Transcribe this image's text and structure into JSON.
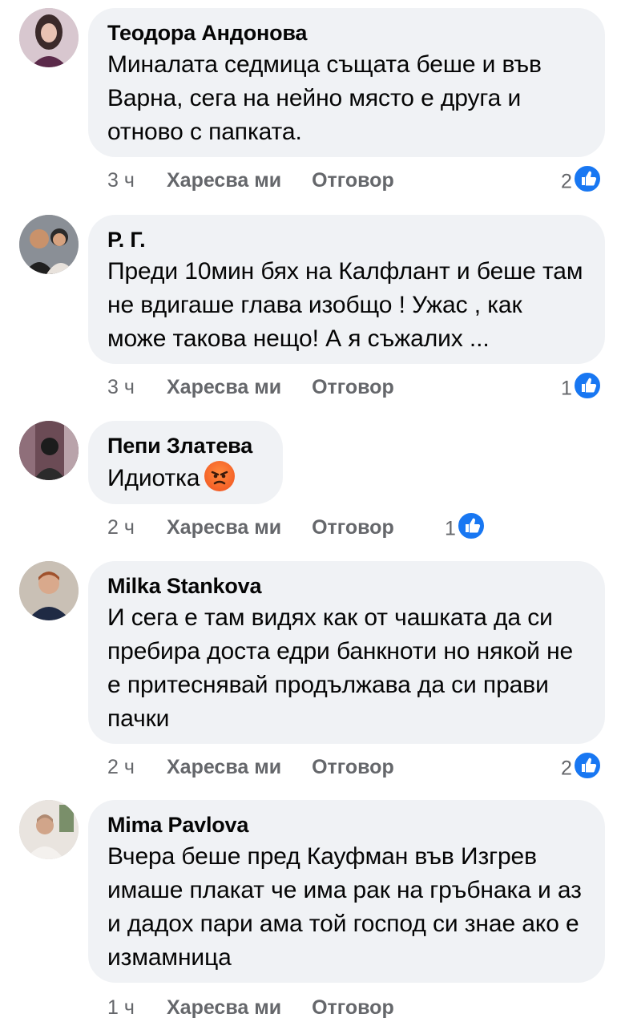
{
  "comments": [
    {
      "author": "Теодора Андонова",
      "text": "Миналата седмица същата беше и във Варна, сега на нейно място е друга и отново с папката.",
      "time": "3 ч",
      "like_label": "Харесва ми",
      "reply_label": "Отговор",
      "reaction_count": "2",
      "reaction_icon": "like-icon",
      "avatar_colors": [
        "#d8c7cf",
        "#3b2a2a",
        "#e8c2b3"
      ]
    },
    {
      "author": "Р. Г.",
      "text": "Преди 10мин бях на Калфлант и беше там не вдигаше глава изобщо ! Ужас , как може такова нещо! А я съжалих ...",
      "time": "3 ч",
      "like_label": "Харесва ми",
      "reply_label": "Отговор",
      "reaction_count": "1",
      "reaction_icon": "like-icon",
      "avatar_colors": [
        "#8a8f96",
        "#2a2a2a",
        "#c9926b"
      ]
    },
    {
      "author": "Пепи Златева",
      "text": "Идиотка",
      "emoji": "angry-face-emoji",
      "time": "2 ч",
      "like_label": "Харесва ми",
      "reply_label": "Отговор",
      "reaction_count": "1",
      "reaction_icon": "like-icon",
      "avatar_colors": [
        "#6b4b55",
        "#1c1c1c",
        "#b9a3aa"
      ]
    },
    {
      "author": "Milka Stankova",
      "text": "И сега е там видях как от чашката да си пребира доста едри банкноти но някой не е притеснявай продължава да си прави пачки",
      "time": "2 ч",
      "like_label": "Харесва ми",
      "reply_label": "Отговор",
      "reaction_count": "2",
      "reaction_icon": "like-icon",
      "avatar_colors": [
        "#c9c0b5",
        "#1f2a44",
        "#d9a98c"
      ]
    },
    {
      "author": "Mima Pavlova",
      "text": "Вчера беше пред Кауфман във Изгрев имаше плакат че има рак на гръбнака и аз и дадох пари ама той господ си знае ако е измамница",
      "time": "1 ч",
      "like_label": "Харесва ми",
      "reply_label": "Отговор",
      "reaction_count": "",
      "reaction_icon": "",
      "avatar_colors": [
        "#e9e4df",
        "#b08a72",
        "#7a8f6a"
      ]
    }
  ]
}
